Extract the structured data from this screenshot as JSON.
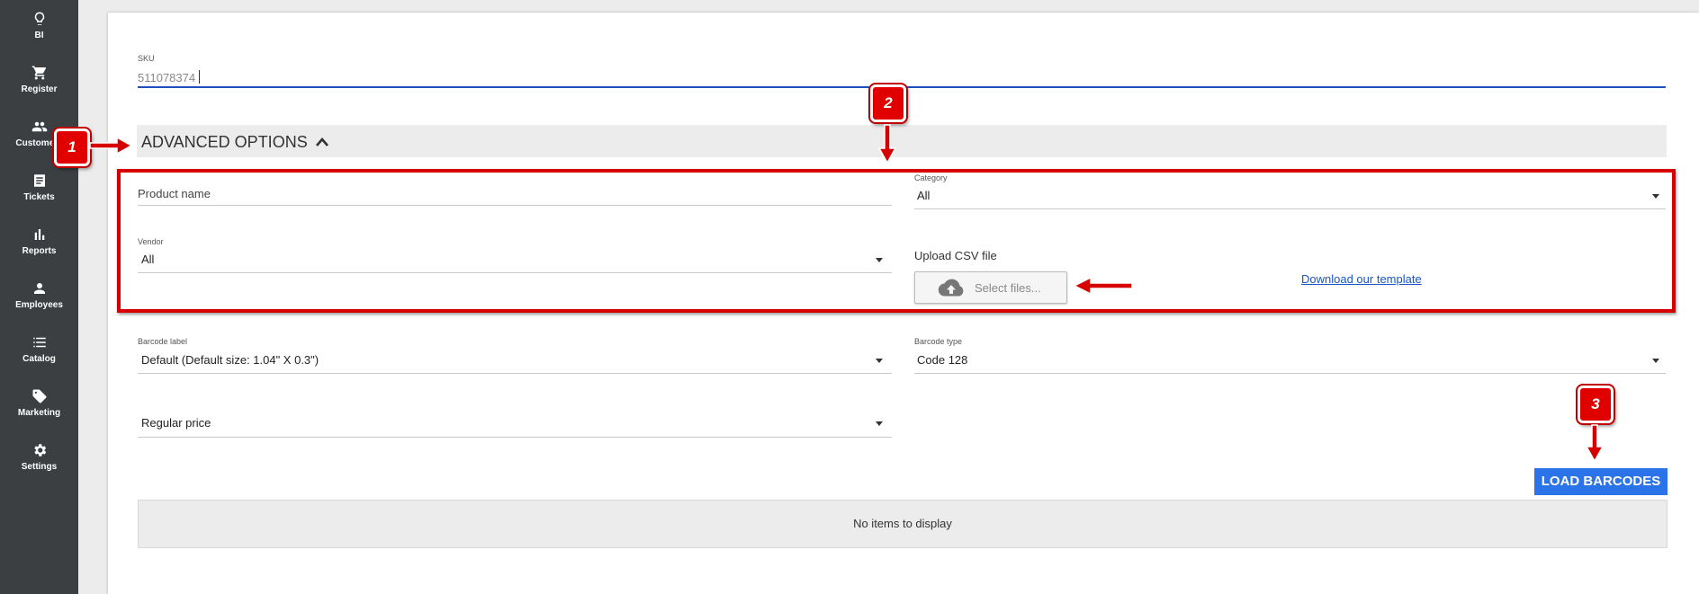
{
  "sidebar": {
    "items": [
      {
        "label": "BI",
        "icon": "lightbulb-icon"
      },
      {
        "label": "Register",
        "icon": "cart-icon"
      },
      {
        "label": "Customers",
        "icon": "people-icon"
      },
      {
        "label": "Tickets",
        "icon": "receipt-icon"
      },
      {
        "label": "Reports",
        "icon": "bar-chart-icon"
      },
      {
        "label": "Employees",
        "icon": "person-icon"
      },
      {
        "label": "Catalog",
        "icon": "list-icon"
      },
      {
        "label": "Marketing",
        "icon": "tag-icon"
      },
      {
        "label": "Settings",
        "icon": "gear-icon"
      }
    ]
  },
  "sku": {
    "label": "SKU",
    "value": "511078374"
  },
  "advanced": {
    "title": "ADVANCED OPTIONS"
  },
  "product_name": {
    "placeholder": "Product name"
  },
  "category": {
    "label": "Category",
    "value": "All"
  },
  "vendor": {
    "label": "Vendor",
    "value": "All"
  },
  "upload": {
    "label": "Upload CSV file",
    "button": "Select files...",
    "template_link": "Download our template"
  },
  "barcode_label": {
    "label": "Barcode label",
    "value": "Default (Default size: 1.04\" X 0.3\")"
  },
  "barcode_type": {
    "label": "Barcode type",
    "value": "Code 128"
  },
  "price": {
    "value": "Regular price"
  },
  "load_button": "LOAD BARCODES",
  "grid": {
    "empty_message": "No items to display"
  },
  "annotations": {
    "badge1": "1",
    "badge2": "2",
    "badge3": "3"
  },
  "colors": {
    "sidebar": "#3b3f42",
    "accent": "#2b73e8",
    "annotation": "#d60000",
    "sku_underline": "#1f4fbf"
  }
}
